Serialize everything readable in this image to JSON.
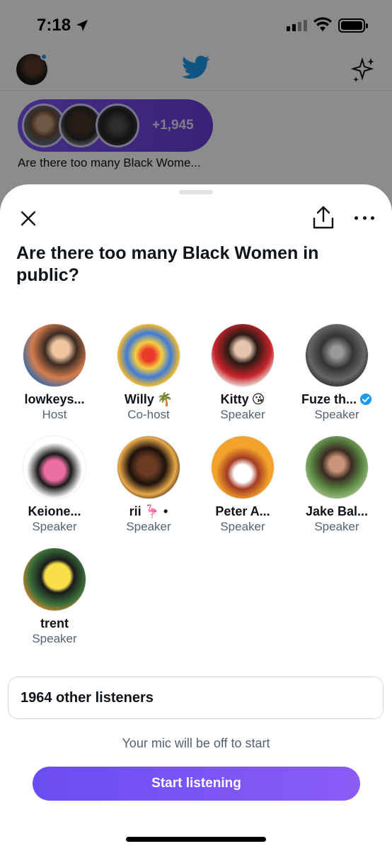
{
  "status_bar": {
    "time": "7:18"
  },
  "spaces_bar": {
    "listener_count": "+1,945",
    "title": "Are there too many Black Wome..."
  },
  "sheet": {
    "title": "Are there too many Black Women in public?",
    "participants": [
      {
        "name": "lowkeys...",
        "role": "Host",
        "emoji": ""
      },
      {
        "name": "Willy",
        "role": "Co-host",
        "emoji": "🌴"
      },
      {
        "name": "Kitty",
        "role": "Speaker",
        "emoji": "😘"
      },
      {
        "name": "Fuze th...",
        "role": "Speaker",
        "emoji": "",
        "verified": true
      },
      {
        "name": "Keione...",
        "role": "Speaker",
        "emoji": ""
      },
      {
        "name": "rii",
        "role": "Speaker",
        "emoji": "🦩 •"
      },
      {
        "name": "Peter A...",
        "role": "Speaker",
        "emoji": ""
      },
      {
        "name": "Jake Bal...",
        "role": "Speaker",
        "emoji": ""
      },
      {
        "name": "trent",
        "role": "Speaker",
        "emoji": ""
      }
    ],
    "listeners_label": "1964 other listeners",
    "mic_note": "Your mic will be off to start",
    "start_button": "Start listening"
  },
  "colors": {
    "accent": "#7b55f0",
    "twitter_blue": "#1d9bf0",
    "secondary_text": "#536471"
  }
}
